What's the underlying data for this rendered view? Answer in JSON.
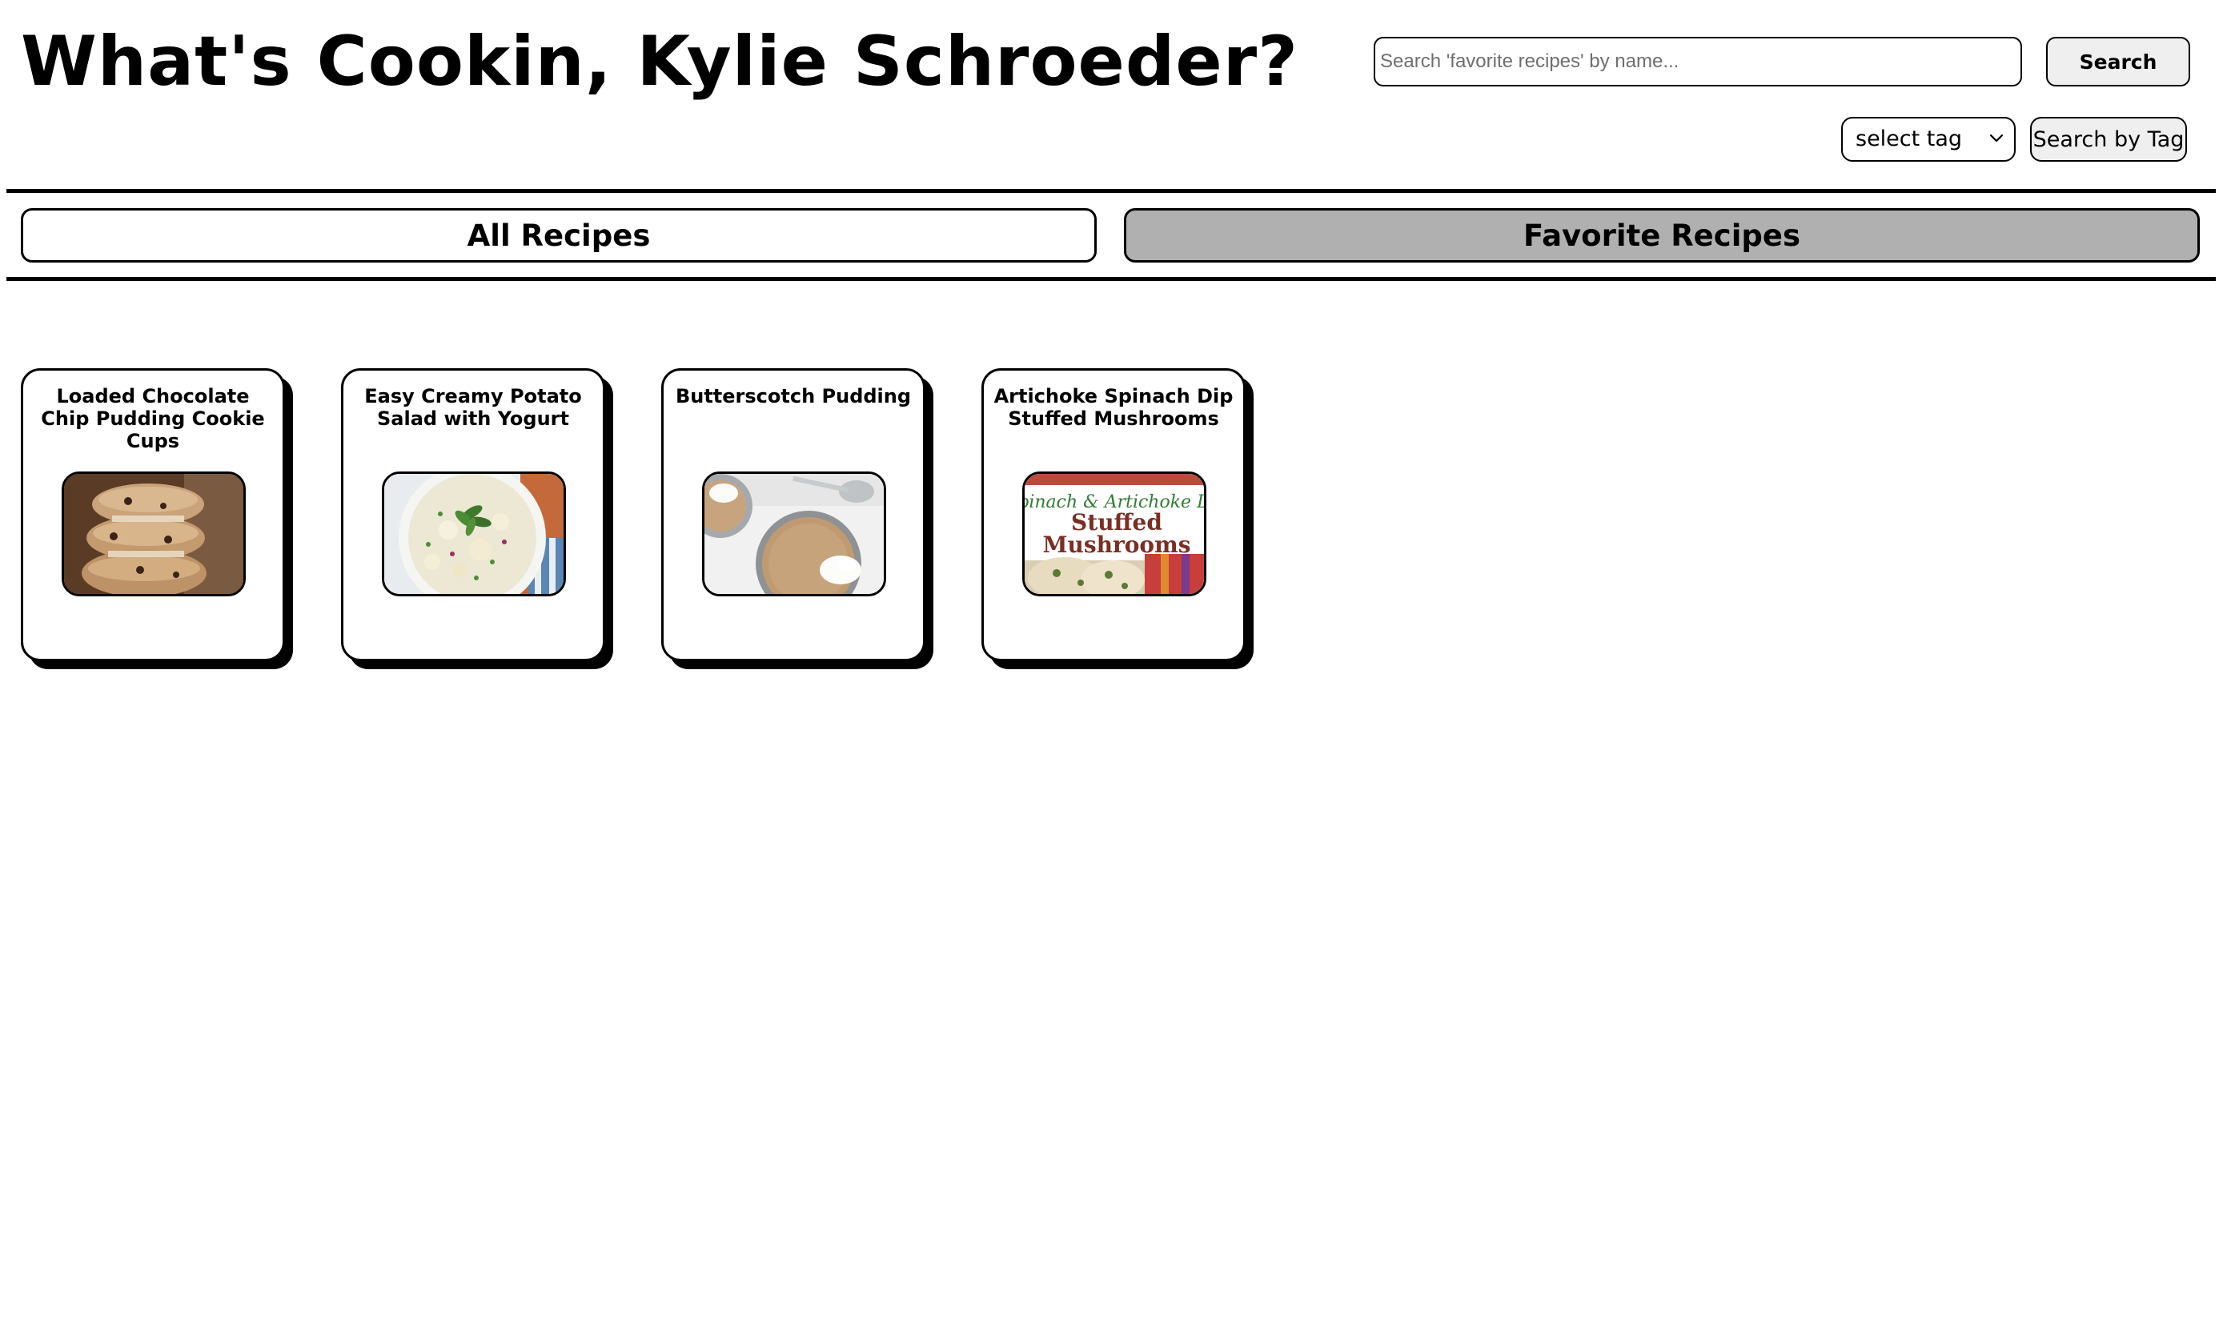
{
  "header": {
    "title": "What's Cookin, Kylie Schroeder?",
    "search_placeholder": "Search 'favorite recipes' by name...",
    "search_value": "",
    "search_button": "Search",
    "tag_select_value": "select tag",
    "tag_search_button": "Search by Tag"
  },
  "nav": {
    "tabs": [
      {
        "label": "All Recipes",
        "active": false
      },
      {
        "label": "Favorite Recipes",
        "active": true
      }
    ],
    "active_color": "#b0b0b0"
  },
  "recipes": [
    {
      "title": "Loaded Chocolate Chip Pudding Cookie Cups",
      "image": "stacked-cookies"
    },
    {
      "title": "Easy Creamy Potato Salad with Yogurt",
      "image": "potato-salad-bowl"
    },
    {
      "title": "Butterscotch Pudding",
      "image": "pudding-cups"
    },
    {
      "title": "Artichoke Spinach Dip Stuffed Mushrooms",
      "image": "stuffed-mushrooms-banner",
      "image_text": {
        "line1": "Spinach & Artichoke Dip",
        "line2": "Stuffed",
        "line3": "Mushrooms"
      }
    }
  ]
}
